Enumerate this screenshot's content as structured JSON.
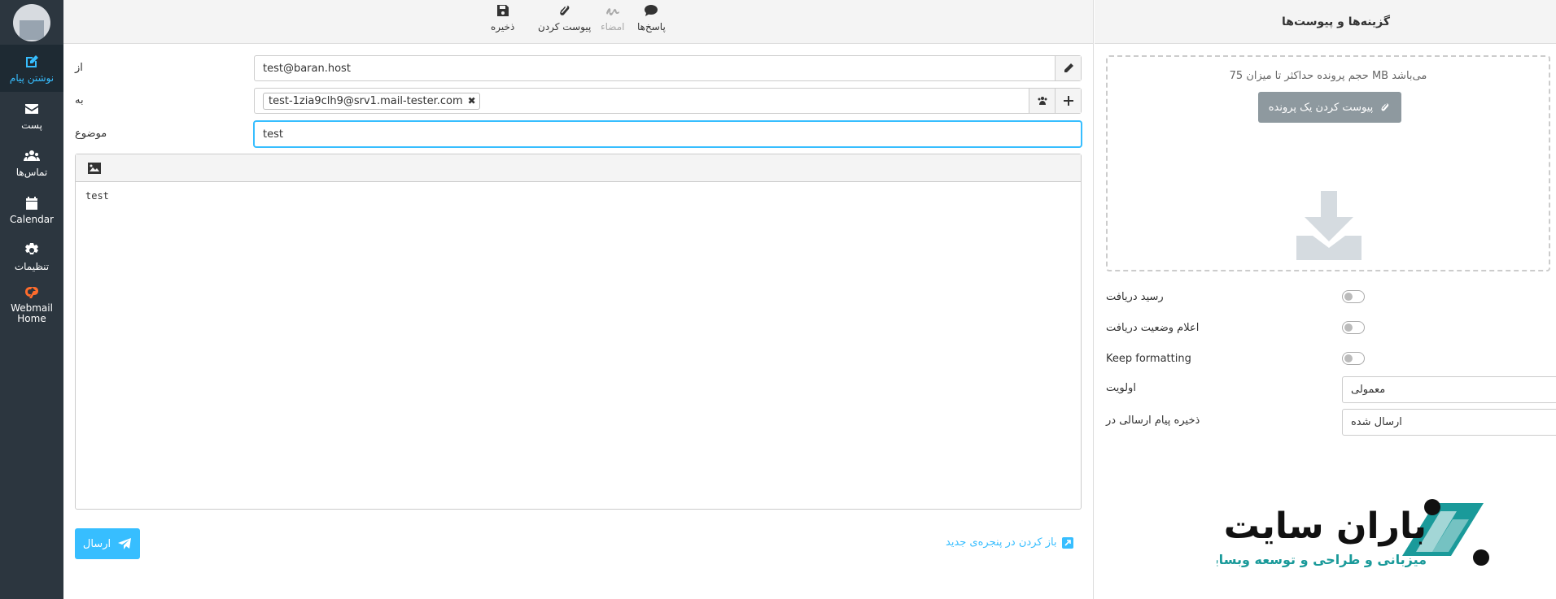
{
  "nav": {
    "items": [
      {
        "label": "نوشتن پیام",
        "icon": "compose-icon"
      },
      {
        "label": "پست",
        "icon": "envelope-icon"
      },
      {
        "label": "تماس‌ها",
        "icon": "users-icon"
      },
      {
        "label": "Calendar",
        "icon": "calendar-icon"
      },
      {
        "label": "تنظیمات",
        "icon": "gear-icon"
      },
      {
        "label": "Webmail Home",
        "icon": "cpanel-icon"
      }
    ]
  },
  "toolbar": {
    "replies": "پاسخ‌ها",
    "signature": "امضاء",
    "attach": "پیوست کردن",
    "save": "ذخیره"
  },
  "compose": {
    "from_label": "از",
    "from_value": "test@baran.host",
    "to_label": "به",
    "to_recipient": "test-1zia9clh9@srv1.mail-tester.com",
    "subject_label": "موضوع",
    "subject_value": "test",
    "body": "test",
    "send_label": "ارسال",
    "open_new_window": "باز کردن در پنجره‌ی جدید"
  },
  "side": {
    "title": "گزینه‌ها و پیوست‌ها",
    "max_size_hint": "حجم پرونده حداکثر تا میزان 75 MB می‌باشد",
    "attach_button": "پیوست کردن یک پرونده",
    "options": {
      "read_receipt": "رسید دریافت",
      "delivery_status": "اعلام وضعیت دریافت",
      "keep_formatting": "Keep formatting",
      "priority_label": "اولویت",
      "priority_value": "معمولی",
      "save_sent_label": "ذخیره پیام ارسالی در",
      "save_sent_value": "ارسال شده"
    }
  },
  "brand": {
    "name": "باران سایت",
    "tagline": "میزبانی و طراحی و توسعه وبسایت",
    "color_teal": "#1a9a9a",
    "color_dark": "#111111"
  },
  "colors": {
    "accent": "#37beff",
    "nav_bg": "#2c363f",
    "attach_btn": "#8e999f"
  }
}
